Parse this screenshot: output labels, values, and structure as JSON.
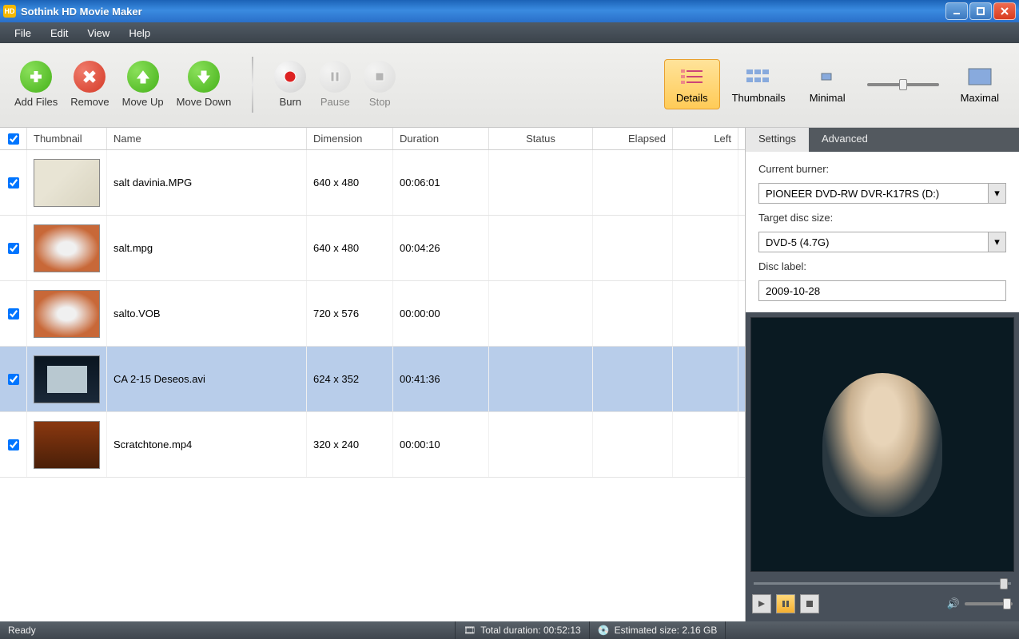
{
  "titlebar": {
    "app_name": "Sothink HD Movie Maker"
  },
  "menu": {
    "items": [
      "File",
      "Edit",
      "View",
      "Help"
    ]
  },
  "toolbar": {
    "add_files": "Add Files",
    "remove": "Remove",
    "move_up": "Move Up",
    "move_down": "Move Down",
    "burn": "Burn",
    "pause": "Pause",
    "stop": "Stop",
    "details": "Details",
    "thumbnails": "Thumbnails",
    "minimal": "Minimal",
    "maximal": "Maximal"
  },
  "columns": {
    "thumbnail": "Thumbnail",
    "name": "Name",
    "dimension": "Dimension",
    "duration": "Duration",
    "status": "Status",
    "elapsed": "Elapsed",
    "left": "Left"
  },
  "files": [
    {
      "checked": true,
      "name": "salt davinia.MPG",
      "dimension": "640 x 480",
      "duration": "00:06:01",
      "selected": false
    },
    {
      "checked": true,
      "name": "salt.mpg",
      "dimension": "640 x 480",
      "duration": "00:04:26",
      "selected": false
    },
    {
      "checked": true,
      "name": "salto.VOB",
      "dimension": "720 x 576",
      "duration": "00:00:00",
      "selected": false
    },
    {
      "checked": true,
      "name": "CA 2-15 Deseos.avi",
      "dimension": "624 x 352",
      "duration": "00:41:36",
      "selected": true
    },
    {
      "checked": true,
      "name": "Scratchtone.mp4",
      "dimension": "320 x 240",
      "duration": "00:00:10",
      "selected": false
    }
  ],
  "panel": {
    "tabs": {
      "settings": "Settings",
      "advanced": "Advanced"
    },
    "current_burner_label": "Current burner:",
    "current_burner_value": "PIONEER DVD-RW DVR-K17RS (D:)",
    "target_disc_label": "Target disc size:",
    "target_disc_value": "DVD-5 (4.7G)",
    "disc_label_label": "Disc label:",
    "disc_label_value": "2009-10-28"
  },
  "status": {
    "ready": "Ready",
    "total_duration": "Total duration: 00:52:13",
    "estimated_size": "Estimated size: 2.16 GB"
  }
}
